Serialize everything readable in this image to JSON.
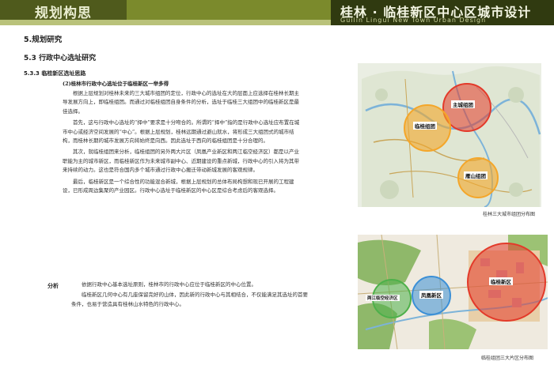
{
  "header": {
    "left_title": "规划构思",
    "right_title": "桂林 · 临桂新区中心区城市设计",
    "right_subtitle": "Guilin Lingui New Town Urban Design"
  },
  "section": {
    "h1": "5.规划研究",
    "h2": "5.3 行政中心选址研究",
    "h3": "5.3.3 临桂新区选址思路",
    "subheading": "(2)桂林市行政中心选址位于临桂新区一举多得",
    "paragraphs": [
      "根据上层规划对桂林未来的三大城市组团的定位，行政中心的选址在大的层面上应选择在桂林长期主导发展方向上，即临桂组团。而通过对临桂组团自身条件的分析，选址于临桂三大组团中的临桂新区是最佳选择。",
      "首先，这与行政中心选址的“择中”要求是十分吻合的。所谓的“择中”指的是行政中心选址应布置在城市中心或经济空间发展的“中心”。根据上层规划，桂林远期通过避山就水，将形成三大组团式的城市结构，而桂林长期的城市发展方向将始终是向西。因此选址于西向的临桂组团是十分合理的。",
      "其次，就临桂组团来分析，临桂组团的另外两大片区（凤凰产业新区和两江临空经济区）都是以产业职能为主的城市新区，而临桂新区作为未来城市副中心、近期建设的重点新城，行政中心的引入将为其带来持续的动力。这也是符合国内多个城市通过行政中心搬迁带动新城发展的客观规律。",
      "最后，临桂新区是一个综合性的功能混合新城，根据上层规划的总体布局构想和现已开展的工程建设，已形成周边集聚的产业园区。行政中心选址于临桂新区的中心区是综合考虑后的客观选择。"
    ],
    "analysis_label": "分析",
    "analysis_paragraphs": [
      "依据行政中心基本选址原则，桂林市的行政中心应位于临桂新区的中心位置。",
      "临桂新区几何中心有几座保留完好的山体，因此新的行政中心与其相结合，不仅能满足其选址的首要条件，也易于营造具有桂林山水特色的行政中心。"
    ]
  },
  "map_top": {
    "caption": "桂林三大城市组团分布图",
    "labels": {
      "main": "主城组团",
      "lingui": "临桂组团",
      "yanshan": "雁山组团"
    }
  },
  "map_bottom": {
    "caption": "临桂组团三大片区分布图",
    "labels": {
      "xinqu": "临桂新区",
      "fenghuang": "凤凰新区",
      "liangjiang": "两江临空经济区"
    }
  },
  "colors": {
    "header_green": "#7b8a2c",
    "header_dark": "#303a10",
    "circle_red": "#e33a2a",
    "circle_orange": "#f4a62a",
    "circle_green": "#4db04a",
    "circle_blue": "#3b8fd6"
  }
}
